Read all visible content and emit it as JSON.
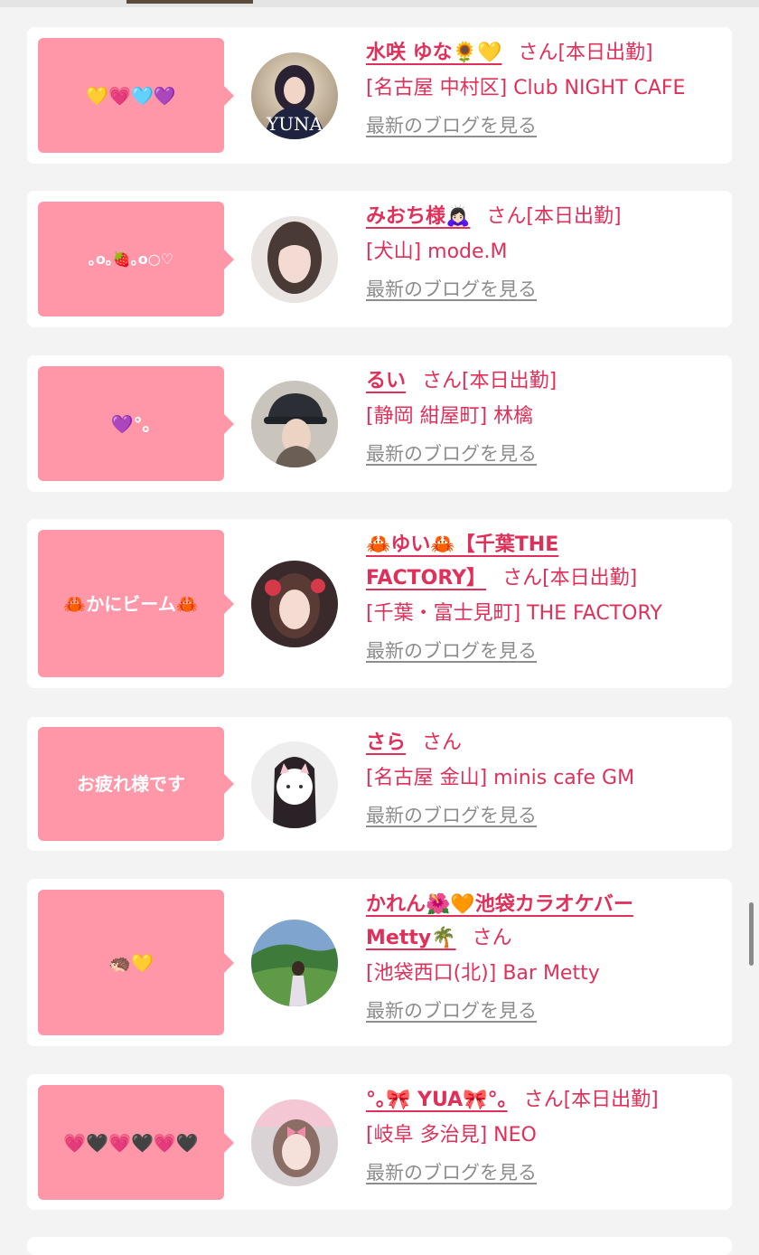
{
  "entries": [
    {
      "bubble": "💛💗🩵💜",
      "name": "水咲 ゆな🌻💛",
      "name2": "",
      "suffix": "さん[本日出勤]",
      "shop": "[名古屋 中村区] Club NIGHT CAFE",
      "blog": "最新のブログを見る",
      "avatar_text": "YUNA"
    },
    {
      "bubble": "｡o｡🍓｡o○♡",
      "name": "みおち様🙇🏻‍♀️",
      "name2": "",
      "suffix": "さん[本日出勤]",
      "shop": "[犬山] mode.M",
      "blog": "最新のブログを見る"
    },
    {
      "bubble": "💜°｡",
      "name": "るい",
      "name2": "",
      "suffix": "さん[本日出勤]",
      "shop": "[静岡 紺屋町] 林檎",
      "blog": "最新のブログを見る"
    },
    {
      "bubble": "🦀かにビーム🦀",
      "name": "🦀ゆい🦀【千葉THE",
      "name2": "FACTORY】",
      "suffix": "さん[本日出勤]",
      "shop": "[千葉・富士見町] THE FACTORY",
      "blog": "最新のブログを見る"
    },
    {
      "bubble": "お疲れ様です",
      "name": "さら",
      "name2": "",
      "suffix": "さん",
      "shop": "[名古屋 金山] minis cafe GM",
      "blog": "最新のブログを見る"
    },
    {
      "bubble": "🦔💛",
      "name": "かれん🌺🧡池袋カラオケバー",
      "name2": "Metty🌴",
      "suffix": "さん",
      "shop": "[池袋西口(北)] Bar Metty",
      "blog": "最新のブログを見る"
    },
    {
      "bubble": "💗🖤💗🖤💗🖤",
      "name": "°｡🎀 YUA🎀°｡",
      "name2": "",
      "suffix": "さん[本日出勤]",
      "shop": "[岐阜 多治見] NEO",
      "blog": "最新のブログを見る"
    }
  ]
}
